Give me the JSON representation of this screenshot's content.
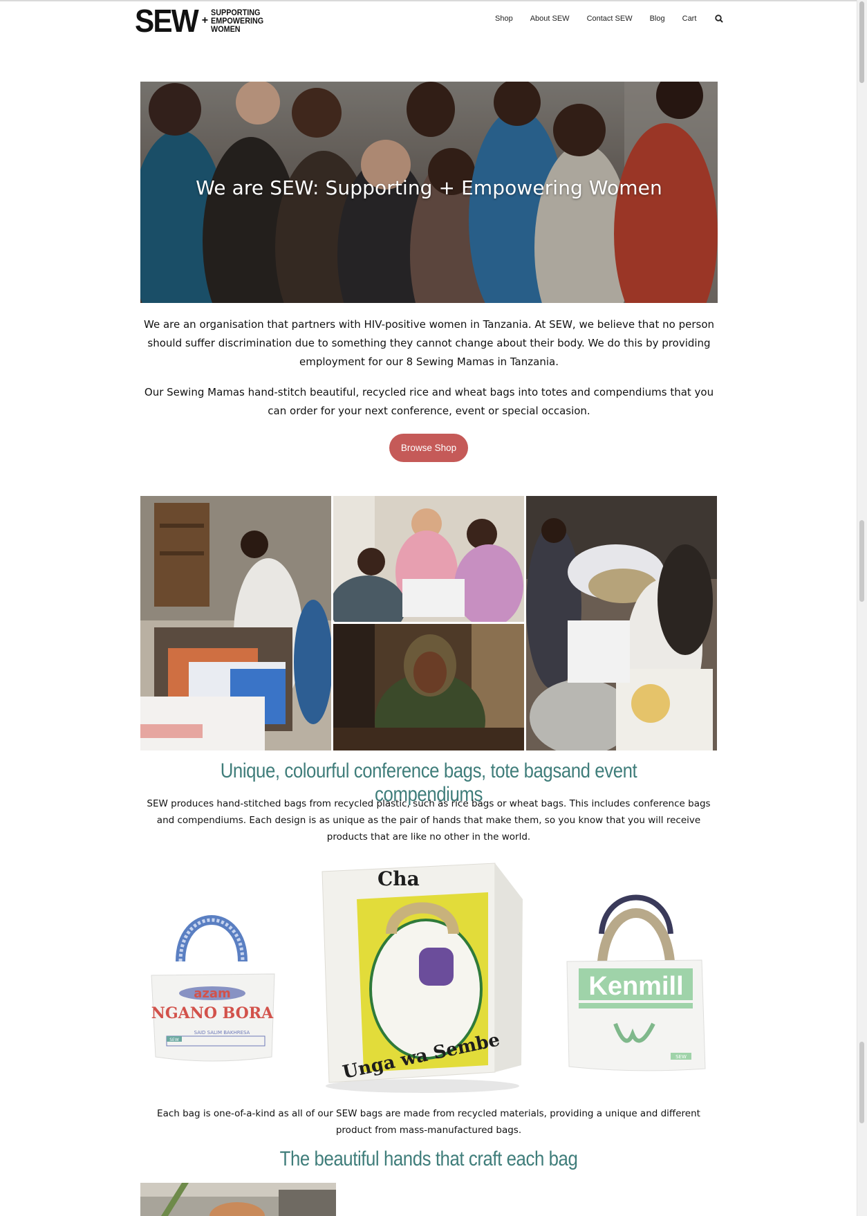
{
  "logo": {
    "name": "SEW",
    "plus": "+",
    "tagline": [
      "SUPPORTING",
      "EMPOWERING",
      "WOMEN"
    ]
  },
  "nav": {
    "items": [
      "Shop",
      "About SEW",
      "Contact SEW",
      "Blog",
      "Cart"
    ],
    "search_icon": "search-icon"
  },
  "hero": {
    "title": "We are SEW: Supporting + Empowering Women"
  },
  "intro": {
    "paragraph1": "We are an organisation that partners with HIV-positive women in Tanzania. At SEW, we believe that no person should suffer discrimination due to something they cannot change about their body. We do this by providing employment for our 8 Sewing Mamas in Tanzania.",
    "paragraph2": "Our Sewing Mamas hand-stitch beautiful, recycled rice and wheat bags into totes and compendiums that you can order for your next conference, event or special occasion.",
    "button_label": "Browse Shop"
  },
  "section_bags": {
    "heading": "Unique, colourful conference bags, tote bagsand event compendiums",
    "description": "SEW produces hand-stitched bags from recycled plastic, such as rice bags or wheat bags. This includes conference bags and compendiums. Each design is as unique as the pair of hands that make them, so you know that you will receive products that are like no other in the world.",
    "bag_prints": [
      {
        "brand": "azam",
        "text": "NGANO BORA",
        "small": "SAID SALIM BAKHRESA",
        "tag": "SEW"
      },
      {
        "brand": "Cha",
        "text": "Unga wa Sembe"
      },
      {
        "brand": "Kenmill",
        "tag": "SEW"
      }
    ],
    "footer_text": "Each bag is one-of-a-kind as all of our SEW bags are made from recycled materials, providing a unique and different product from mass-manufactured bags."
  },
  "section_hands": {
    "heading": "The beautiful hands that craft each bag"
  },
  "colors": {
    "accent_teal": "#3f7d7a",
    "button_red": "#c55a58"
  }
}
